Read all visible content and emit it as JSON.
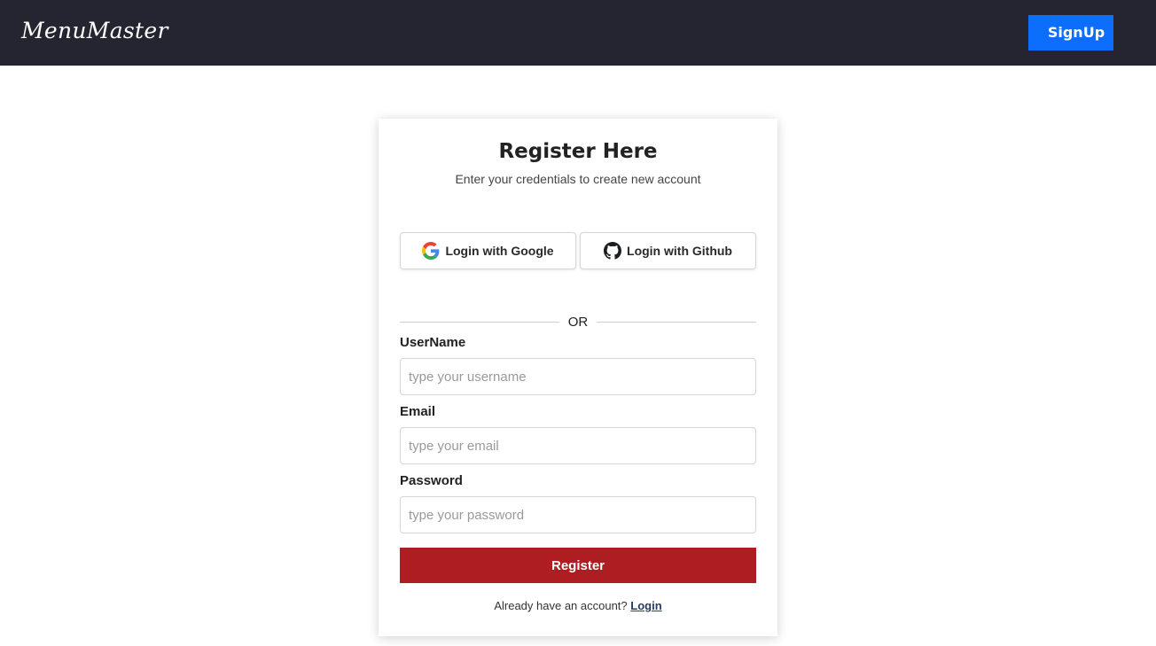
{
  "navbar": {
    "brand": "MenuMaster",
    "signup_label": "SignUp",
    "background": "#252532",
    "signup_color": "#0d6efd"
  },
  "card": {
    "title": "Register Here",
    "subtitle": "Enter your credentials to create new account",
    "google_label": "Login with Google",
    "github_label": "Login with Github",
    "google_icon": "google-logo-icon",
    "github_icon": "github-logo-icon",
    "divider_text": "OR"
  },
  "form": {
    "username_label": "UserName",
    "username_placeholder": "type your username",
    "username_value": "",
    "email_label": "Email",
    "email_placeholder": "type your email",
    "email_value": "",
    "password_label": "Password",
    "password_placeholder": "type your password",
    "password_value": "",
    "register_label": "Register",
    "register_color": "#ad1d22"
  },
  "footer": {
    "prompt": "Already have an account?",
    "login_label": "Login"
  }
}
